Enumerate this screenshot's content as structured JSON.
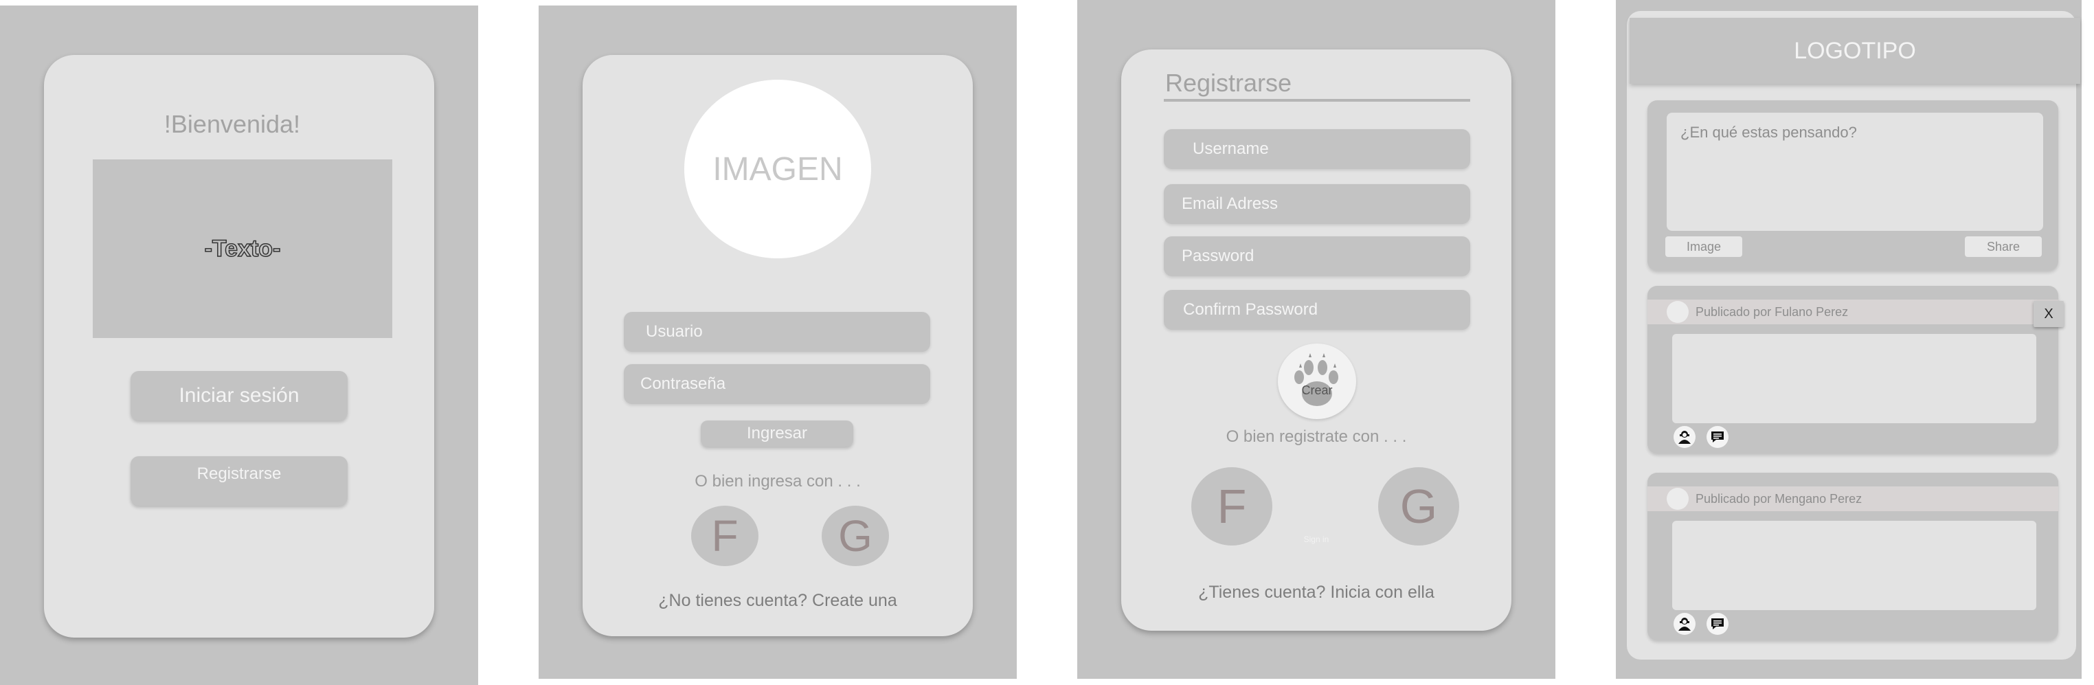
{
  "screens": {
    "welcome": {
      "heading": "!Bienvenida!",
      "text_box_label": "-Texto-",
      "login_button": "Iniciar sesión",
      "register_button": "Registrarse"
    },
    "login": {
      "image_label": "IMAGEN",
      "username_placeholder": "Usuario",
      "password_placeholder": "Contraseña",
      "submit_button": "Ingresar",
      "alt_text": "O bien ingresa con . . .",
      "facebook_label": "F",
      "google_label": "G",
      "signup_link": "¿No tienes cuenta? Create una"
    },
    "register": {
      "title": "Registrarse",
      "username_placeholder": "Username",
      "email_placeholder": "Email Adress",
      "password_placeholder": "Password",
      "confirm_placeholder": "Confirm Password",
      "create_button": "Crear",
      "alt_text": "O bien registrate con . . .",
      "facebook_label": "F",
      "google_label": "G",
      "sign_in_small": "Sign in",
      "login_link": "¿Tienes cuenta? Inicia con ella"
    },
    "feed": {
      "logo": "LOGOTIPO",
      "compose_placeholder": "¿En qué estas pensando?",
      "image_button": "Image",
      "share_button": "Share",
      "close_label": "X",
      "posts": [
        {
          "author": "Publicado por Fulano Perez"
        },
        {
          "author": "Publicado por Mengano Perez"
        }
      ]
    }
  },
  "colors": {
    "background": "#c3c3c3",
    "card": "#e3e3e3",
    "muted_text": "#9b9b9b",
    "letter_icon": "#9a8d8d"
  }
}
